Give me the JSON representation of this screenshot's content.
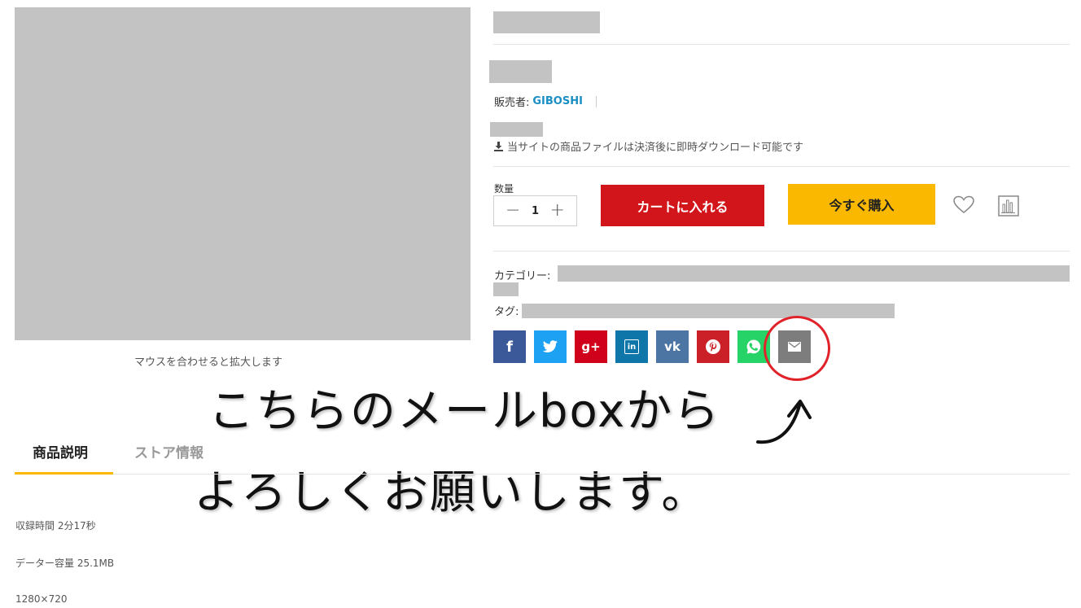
{
  "gallery": {
    "zoom_hint": "マウスを合わせると拡大します"
  },
  "product": {
    "seller_label": "販売者:",
    "seller_name": "GIBOSHI",
    "download_note": "当サイトの商品ファイルは決済後に即時ダウンロード可能です",
    "quantity_label": "数量",
    "quantity_value": "1",
    "minus_symbol": "−",
    "plus_symbol": "+",
    "add_to_cart_label": "カートに入れる",
    "buy_now_label": "今すぐ購入",
    "category_label": "カテゴリー:",
    "tag_label": "タグ:"
  },
  "share": {
    "facebook": "f",
    "google_plus": "g+",
    "linkedin": "in",
    "vk": "vk"
  },
  "annotation": {
    "line1": "こちらのメールboxから",
    "line2": "よろしくお願いします。",
    "circle_color": "#e0232a"
  },
  "tabs": {
    "description": "商品説明",
    "store_info": "ストア情報"
  },
  "specs": {
    "duration": "収録時間 2分17秒",
    "data_size": "データー容量 25.1MB",
    "resolution": "1280×720"
  },
  "colors": {
    "cart_button": "#d2141b",
    "buy_button": "#fbb800",
    "seller_link": "#1b8fc4",
    "facebook": "#3b5998",
    "twitter": "#1da1f2",
    "google_plus": "#d0021b",
    "linkedin": "#0e76a8",
    "vk": "#4c75a3",
    "pinterest": "#cb2027",
    "whatsapp": "#25d366",
    "email": "#7d7d7d"
  }
}
